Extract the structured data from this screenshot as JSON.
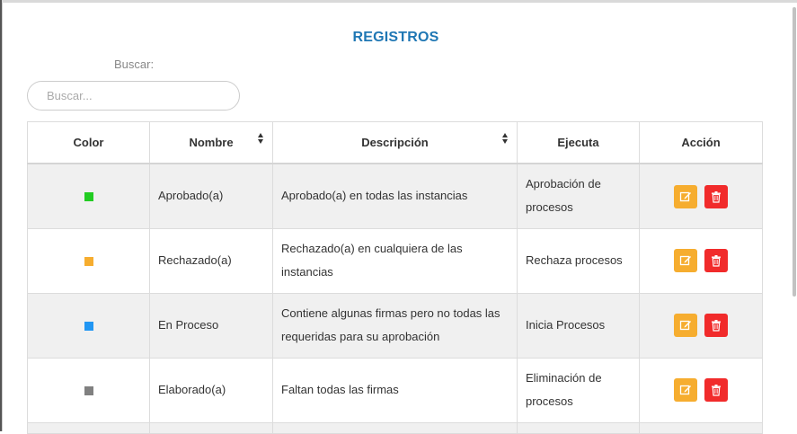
{
  "title": "REGISTROS",
  "search": {
    "label": "Buscar:",
    "placeholder": "Buscar...",
    "value": ""
  },
  "table": {
    "headers": {
      "color": "Color",
      "nombre": "Nombre",
      "descripcion": "Descripción",
      "ejecuta": "Ejecuta",
      "accion": "Acción"
    },
    "rows": [
      {
        "color": "#22cc22",
        "nombre": "Aprobado(a)",
        "descripcion": "Aprobado(a) en todas las instancias",
        "ejecuta": "Aprobación de procesos"
      },
      {
        "color": "#f6ad2f",
        "nombre": "Rechazado(a)",
        "descripcion": "Rechazado(a) en cualquiera de las instancias",
        "ejecuta": "Rechaza procesos"
      },
      {
        "color": "#2196f3",
        "nombre": "En Proceso",
        "descripcion": "Contiene algunas firmas pero no todas las requeridas para su aprobación",
        "ejecuta": "Inicia Procesos"
      },
      {
        "color": "#808080",
        "nombre": "Elaborado(a)",
        "descripcion": "Faltan todas las firmas",
        "ejecuta": "Eliminación de procesos"
      }
    ]
  },
  "colors": {
    "title": "#1f77b4",
    "edit_button": "#f6ad2f",
    "delete_button": "#f12b2b"
  },
  "icons": {
    "edit": "edit-icon",
    "delete": "trash-icon",
    "sort": "sort-icon"
  }
}
